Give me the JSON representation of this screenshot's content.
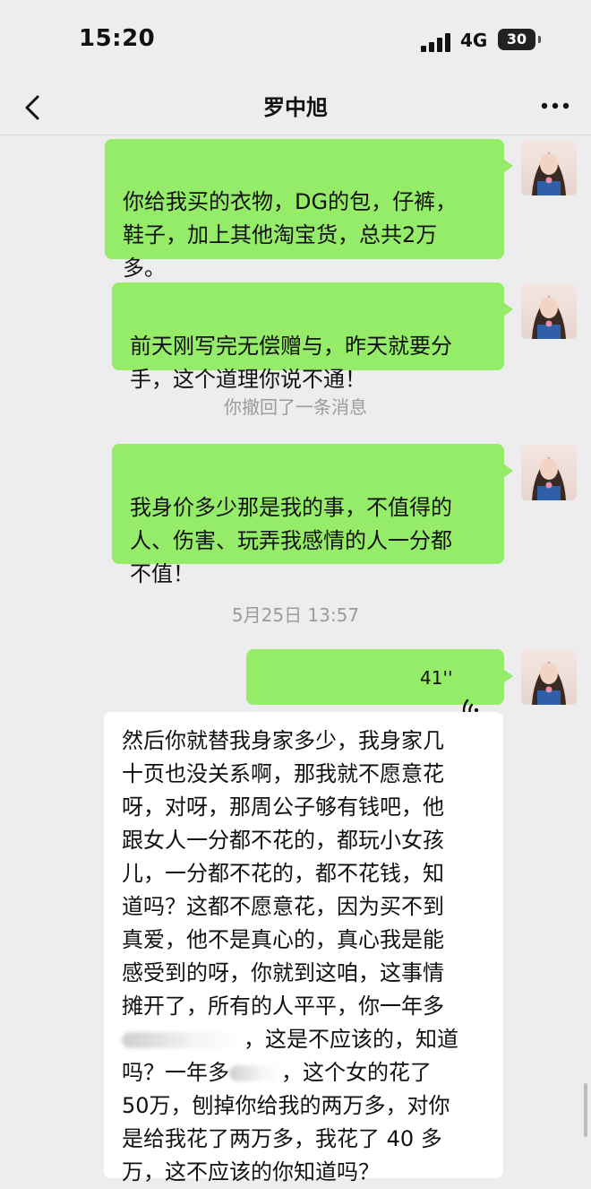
{
  "status": {
    "time": "15:20",
    "network": "4G",
    "battery": "30"
  },
  "header": {
    "title": "罗中旭"
  },
  "icons": {
    "back": "chevron-left-icon",
    "more": "more-dots-icon",
    "voice": "voice-waves-icon",
    "signal": "signal-bars-icon",
    "battery": "battery-icon"
  },
  "messages": [
    {
      "lines": [
        "你给我买的衣物，DG的包，仔裤，",
        "鞋子，加上其他淘宝货，总共2万",
        "多。"
      ]
    },
    {
      "lines": [
        "前天刚写完无偿赠与，昨天就要分",
        "手，这个道理你说不通！"
      ]
    },
    {
      "system": "你撤回了一条消息"
    },
    {
      "lines": [
        "我身价多少那是我的事，不值得的",
        "人、伤害、玩弄我感情的人一分都",
        "不值！"
      ]
    },
    {
      "timestamp": "5月25日 13:57"
    },
    {
      "voice_duration": "41''"
    }
  ],
  "incoming": {
    "lines": [
      "然后你就替我身家多少，我身家几",
      "十页也没关系啊，那我就不愿意花",
      "呀，对呀，那周公子够有钱吧，他",
      "跟女人一分都不花的，都玩小女孩",
      "儿，一分都不花的，都不花钱，知",
      "道吗？这都不愿意花，因为买不到",
      "真爱，他不是真心的，真心我是能",
      "感受到的呀，你就到这咱，这事情",
      "摊开了，所有的人平平，你一年多",
      "，这是不应该的，知道",
      "吗？一年多",
      "，这个女的花了",
      "50万，刨掉你给我的两万多，对你",
      "是给我花了两万多，我花了 40 多",
      "万，这不应该的你知道吗？"
    ]
  },
  "colors": {
    "outgoing": "#95ec69",
    "incoming": "#ffffff",
    "background": "#ededed"
  }
}
